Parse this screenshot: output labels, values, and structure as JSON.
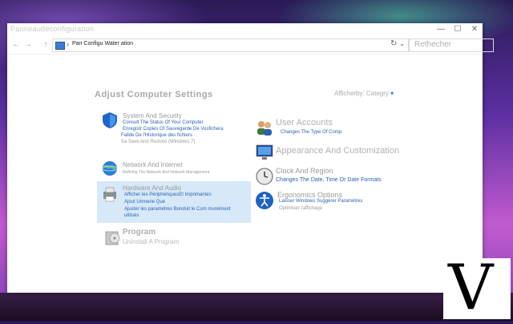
{
  "window": {
    "title": "Panneaudeconfiguration",
    "minimize": "—",
    "maximize": "☐",
    "close": "✕"
  },
  "toolbar": {
    "back": "←",
    "forward": "→",
    "up": "↑",
    "address_sep": "›",
    "address_crumb": "Pan Configu Water ation",
    "address_drop": "⌄",
    "refresh": "↻",
    "search_placeholder": "Rethecher"
  },
  "main": {
    "heading": "Adjust Computer Settings",
    "view_by_label": "Afficherby: Categry",
    "view_by_arrow": "▾"
  },
  "categories_left": [
    {
      "title": "System And Security",
      "subs": [
        {
          "text": "Consult The Status Of Your Computer",
          "style": "link"
        },
        {
          "text": "Enregistr Copies Of Sauvegarde De Vosfichera",
          "style": "link"
        },
        {
          "text": "Fallde De l'Historique des fichiers",
          "style": "link"
        },
        {
          "text": "Sa Save And Restore (Windows 7)",
          "style": "grey"
        }
      ]
    },
    {
      "title": "Network And Internet",
      "subs": [
        {
          "text": "Refining The Network And Network Management",
          "style": "grey"
        }
      ]
    },
    {
      "title": "Hardware And Audio",
      "subs": [
        {
          "text": "Afficher les PériphériquesEt Imprimantes",
          "style": "link"
        },
        {
          "text": "Ajout Umnerie Que",
          "style": "link"
        },
        {
          "text": "Ajuster les paramètres Bonduit le Com munément",
          "style": "link"
        },
        {
          "text": "utilisés",
          "style": "link"
        }
      ]
    },
    {
      "title": "Program",
      "subs": [
        {
          "text": "Uninstall A Program",
          "style": "grey"
        }
      ]
    }
  ],
  "categories_right": [
    {
      "title": "User Accounts",
      "subs": [
        {
          "text": "Changes The Type Of Comp",
          "style": "link"
        }
      ]
    },
    {
      "title": "Appearance And Customization",
      "subs": []
    },
    {
      "title": "Clock And Region",
      "subs": [
        {
          "text": "Changes The Date, Time Or Date Formats",
          "style": "link"
        }
      ]
    },
    {
      "title": "Ergonomics Options",
      "subs": [
        {
          "text": "Laisser Windows Suggérer Paramètres",
          "style": "link"
        },
        {
          "text": "Optimiser l'affichage",
          "style": "grey"
        }
      ]
    }
  ],
  "badge": {
    "letter": "V"
  },
  "colors": {
    "link": "#2a62b5",
    "highlight": "#d7e9f8"
  }
}
